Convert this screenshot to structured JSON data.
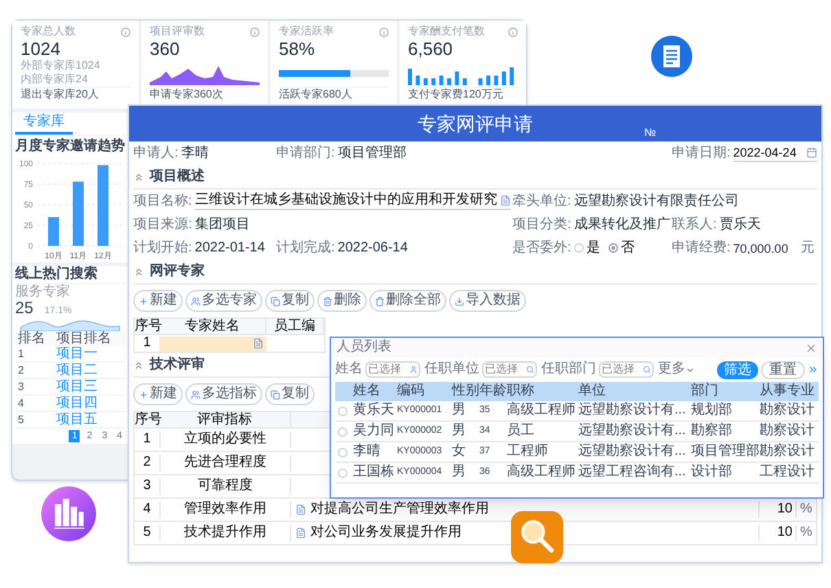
{
  "dashboard": {
    "stats": [
      {
        "kind": "plain",
        "title": "专家总人数",
        "value": "1024",
        "subs": [
          "外部专家库1024",
          "内部专家库24"
        ],
        "footer": "退出专家库20人"
      },
      {
        "kind": "area",
        "title": "项目评审数",
        "value": "360",
        "footer": "申请专家360次"
      },
      {
        "kind": "progress",
        "title": "专家活跃率",
        "value": "58%",
        "level": 0.65,
        "footer": "活跃专家680人"
      },
      {
        "kind": "bars",
        "title": "专家酬支付笔数",
        "value": "6,560",
        "footer": "支付专家费120万元"
      }
    ],
    "tabs": [
      {
        "label": "专家库",
        "selected": true
      }
    ],
    "trend": {
      "title": "月度专家邀请趋势",
      "chart_data": {
        "type": "bar",
        "categories": [
          "10月",
          "11月",
          "12月"
        ],
        "values": [
          35,
          78,
          98
        ],
        "ylim": [
          0,
          100
        ],
        "yticks": [
          0,
          25,
          50,
          75,
          100
        ],
        "grid": true
      }
    },
    "hot_search": {
      "title": "线上热门搜索",
      "metric_label": "服务专家",
      "metric_value": "25",
      "change": "17.1%",
      "columns": [
        "排名",
        "项目排名"
      ],
      "rows": [
        [
          "1",
          "项目一"
        ],
        [
          "2",
          "项目二"
        ],
        [
          "3",
          "项目三"
        ],
        [
          "4",
          "项目四"
        ],
        [
          "5",
          "项目五"
        ]
      ],
      "pages": [
        {
          "label": "1",
          "selected": true
        },
        {
          "label": "2",
          "selected": false
        },
        {
          "label": "3",
          "selected": false
        },
        {
          "label": "4",
          "selected": false
        }
      ]
    }
  },
  "form": {
    "title": "专家网评申请",
    "number_label": "№",
    "header_fields": [
      {
        "kind": "text",
        "label": "申请人:",
        "value": "李晴"
      },
      {
        "kind": "text",
        "label": "申请部门:",
        "value": "项目管理部"
      },
      {
        "kind": "date",
        "label": "申请日期:",
        "value": "2022-04-24"
      }
    ],
    "sections": [
      {
        "title": "项目概述",
        "rows": [
          [
            {
              "kind": "lookup",
              "label": "项目名称:",
              "value": "三维设计在城乡基础设施设计中的应用和开发研究"
            },
            "",
            {
              "kind": "text",
              "label": "牵头单位:",
              "value": "远望勘察设计有限责任公司"
            }
          ],
          [
            {
              "kind": "text",
              "label": "项目来源:",
              "value": "集团项目"
            },
            "",
            {
              "kind": "text",
              "label": "项目分类:",
              "value": "成果转化及推广"
            },
            {
              "kind": "text",
              "label": "联系人:",
              "value": "贾乐天"
            }
          ],
          [
            {
              "kind": "text",
              "label": "计划开始:",
              "value": "2022-01-14"
            },
            {
              "kind": "text",
              "label": "计划完成:",
              "value": "2022-06-14"
            },
            {
              "kind": "radio",
              "label": "是否委外:",
              "options": [
                {
                  "label": "是",
                  "selected": false
                },
                {
                  "label": "否",
                  "selected": true
                }
              ]
            },
            {
              "kind": "money",
              "label": "申请经费:",
              "value": "70,000.00",
              "unit": "元"
            }
          ]
        ]
      },
      {
        "title": "网评专家",
        "buttons": [
          "新建",
          "多选专家",
          "复制",
          "删除",
          "删除全部",
          "导入数据"
        ],
        "columns": [
          "序号",
          "专家姓名",
          "员工编"
        ],
        "rows": [
          {
            "index": "1"
          }
        ]
      },
      {
        "title": "技术评审",
        "buttons": [
          "新建",
          "多选指标",
          "复制"
        ],
        "columns": [
          "序号",
          "评审指标"
        ],
        "rows": [
          {
            "index": "1",
            "indicator": "立项的必要性"
          },
          {
            "index": "2",
            "indicator": "先进合理程度"
          },
          {
            "index": "3",
            "indicator": "可靠程度"
          },
          {
            "index": "4",
            "indicator": "管理效率作用",
            "description": "对提高公司生产管理效率作用",
            "score": "10",
            "unit": "%"
          },
          {
            "index": "5",
            "indicator": "技术提升作用",
            "description": "对公司业务发展提升作用",
            "score": "10",
            "unit": "%"
          }
        ]
      }
    ]
  },
  "dialog": {
    "title": "人员列表",
    "filters": [
      {
        "label": "姓名",
        "placeholder": "已选择"
      },
      {
        "label": "任职单位",
        "placeholder": "已选择"
      },
      {
        "label": "任职部门",
        "placeholder": "已选择"
      }
    ],
    "more": "更多",
    "buttons": [
      {
        "kind": "primary",
        "label": "筛选"
      },
      {
        "kind": "default",
        "label": "重置"
      }
    ],
    "columns": [
      "姓名",
      "编码",
      "性别",
      "年龄",
      "职称",
      "单位",
      "部门",
      "从事专业"
    ],
    "rows": [
      {
        "selected": false,
        "cells": [
          "黄乐天",
          "KY000001",
          "男",
          "35",
          "高级工程师",
          "远望勘察设计有...",
          "规划部",
          "勘察设计"
        ]
      },
      {
        "selected": false,
        "cells": [
          "吴力同",
          "KY000002",
          "男",
          "34",
          "员工",
          "远望勘察设计有...",
          "勘察部",
          "勘察设计"
        ]
      },
      {
        "selected": false,
        "cells": [
          "李晴",
          "KY000003",
          "女",
          "37",
          "工程师",
          "远望勘察设计有...",
          "项目管理部",
          "勘察设计"
        ]
      },
      {
        "selected": false,
        "cells": [
          "王国栋",
          "KY000004",
          "男",
          "36",
          "高级工程师",
          "远望工程咨询有...",
          "设计部",
          "工程设计"
        ]
      }
    ]
  }
}
